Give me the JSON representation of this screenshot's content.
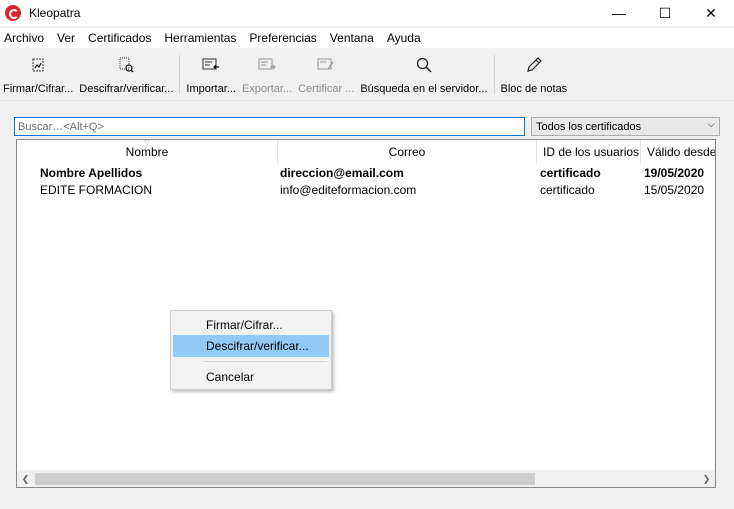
{
  "window": {
    "title": "Kleopatra",
    "controls": {
      "minimize": "—",
      "maximize": "☐",
      "close": "✕"
    }
  },
  "menu": [
    "Archivo",
    "Ver",
    "Certificados",
    "Herramientas",
    "Preferencias",
    "Ventana",
    "Ayuda"
  ],
  "toolbar": {
    "sign_encrypt": "Firmar/Cifrar...",
    "decrypt_verify": "Descifrar/verificar...",
    "import": "Importar...",
    "export": "Exportar...",
    "certify": "Certificar ...",
    "server_search": "Búsqueda en el servidor...",
    "notepad": "Bloc de notas"
  },
  "search": {
    "placeholder": "Buscar…<Alt+Q>",
    "filter_selected": "Todos los certificados"
  },
  "table": {
    "columns": [
      "Nombre",
      "Correo",
      "ID de los usuarios",
      "Válido desde"
    ],
    "rows": [
      {
        "name": "Nombre Apellidos",
        "email": "direccion@email.com",
        "user_id": "certificado",
        "valid_from": "19/05/2020"
      },
      {
        "name": "EDITE FORMACION",
        "email": "info@editeformacion.com",
        "user_id": "certificado",
        "valid_from": "15/05/2020"
      }
    ]
  },
  "context_menu": {
    "items": [
      "Firmar/Cifrar...",
      "Descifrar/verificar...",
      "Cancelar"
    ],
    "highlighted": "Descifrar/verificar..."
  },
  "colors": {
    "selection_highlight": "#91c9f7",
    "focus_border": "#0078d7",
    "app_icon": "#d9262b"
  }
}
